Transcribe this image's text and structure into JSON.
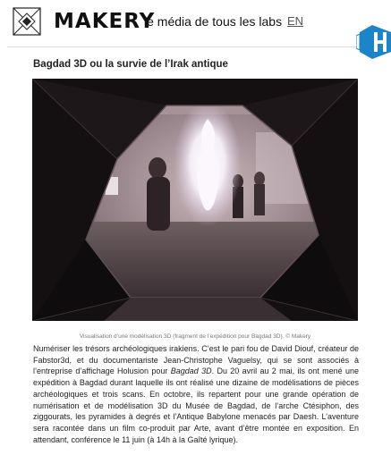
{
  "header": {
    "brand": "MAKERY",
    "tagline": "le média de tous les labs",
    "lang_link": "EN"
  },
  "article": {
    "title": "Bagdad 3D ou la survie de l’Irak antique",
    "caption": "Visualisation d’une modélisation 3D (fragment de l’expédition pour Bagdad 3D). © Makery",
    "body": {
      "p1": "Numériser les trésors archéologiques irakiens. C’est le pari fou de David Diouf, créateur de Fabstor3d, et du documentariste Jean-Christophe Vaguelsy, qui se sont associés à l’entreprise d’affichage Holusion pour ",
      "em": "Bagdad 3D",
      "p2": ". Du 20 avril au 2 mai, ils ont mené une expédition à Bagdad durant laquelle ils ont réalisé une dizaine de modélisations de pièces archéologiques et trois scans. En octobre, ils repartent pour une grande opération de numérisation et de modélisation 3D du Musée de Bagdad, de l’arche Ctésiphon, des ziggourats, les pyramides à degrés et l’Antique Babylone menacés par Daesh. L’aventure sera racontée dans un film co-produit par Arte, avant d’être montée en exposition. En attendant, ",
      "link": "conférence le 11 juin (à 14h à la Gaîté lyrique)",
      "p3": "."
    }
  },
  "colors": {
    "accent_blue": "#1a86c9",
    "text": "#222222",
    "caption": "#777777"
  }
}
